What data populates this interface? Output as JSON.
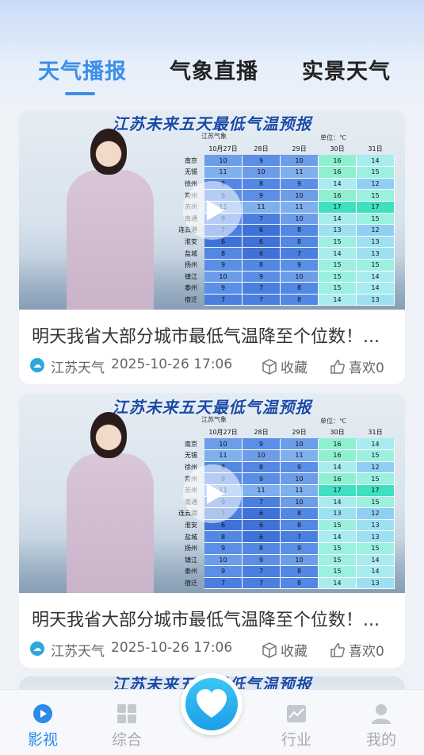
{
  "top_tabs": [
    {
      "label": "天气播报",
      "active": true
    },
    {
      "label": "气象直播",
      "active": false
    },
    {
      "label": "实景天气",
      "active": false
    }
  ],
  "video_table": {
    "title": "江苏未来五天最低气温预报",
    "logo": "江苏气象",
    "unit": "单位：℃",
    "headers": [
      "10月27日",
      "28日",
      "29日",
      "30日",
      "31日"
    ],
    "rows": [
      {
        "city": "南京",
        "values": [
          10,
          9,
          10,
          16,
          14
        ]
      },
      {
        "city": "无锡",
        "values": [
          11,
          10,
          11,
          16,
          15
        ]
      },
      {
        "city": "徐州",
        "values": [
          8,
          8,
          9,
          14,
          12
        ]
      },
      {
        "city": "常州",
        "values": [
          9,
          9,
          10,
          16,
          15
        ]
      },
      {
        "city": "苏州",
        "values": [
          11,
          11,
          11,
          17,
          17
        ]
      },
      {
        "city": "南通",
        "values": [
          9,
          7,
          10,
          14,
          15
        ]
      },
      {
        "city": "连云港",
        "values": [
          7,
          6,
          8,
          13,
          12
        ]
      },
      {
        "city": "淮安",
        "values": [
          6,
          6,
          8,
          15,
          13
        ]
      },
      {
        "city": "盐城",
        "values": [
          8,
          6,
          7,
          14,
          13
        ]
      },
      {
        "city": "扬州",
        "values": [
          9,
          8,
          9,
          15,
          15
        ]
      },
      {
        "city": "镇江",
        "values": [
          10,
          9,
          10,
          15,
          14
        ]
      },
      {
        "city": "泰州",
        "values": [
          9,
          7,
          8,
          15,
          14
        ]
      },
      {
        "city": "宿迁",
        "values": [
          7,
          7,
          8,
          14,
          13
        ]
      }
    ]
  },
  "cards": [
    {
      "title": "明天我省大部分城市最低气温降至个位数！...",
      "source": "江苏天气",
      "time": "2025-10-26 17:06",
      "fav_label": "收藏",
      "like_label": "喜欢0"
    },
    {
      "title": "明天我省大部分城市最低气温降至个位数！...",
      "source": "江苏天气",
      "time": "2025-10-26 17:06",
      "fav_label": "收藏",
      "like_label": "喜欢0"
    }
  ],
  "bottom_nav": [
    {
      "label": "影视",
      "icon": "play-circle-icon",
      "active": true
    },
    {
      "label": "综合",
      "icon": "grid-icon",
      "active": false
    },
    {
      "label": "",
      "icon": "heart-icon",
      "active": false
    },
    {
      "label": "行业",
      "icon": "chart-icon",
      "active": false
    },
    {
      "label": "我的",
      "icon": "person-icon",
      "active": false
    }
  ],
  "colors": {
    "accent": "#3c8ee8",
    "center_button": "#1d9ee8"
  }
}
